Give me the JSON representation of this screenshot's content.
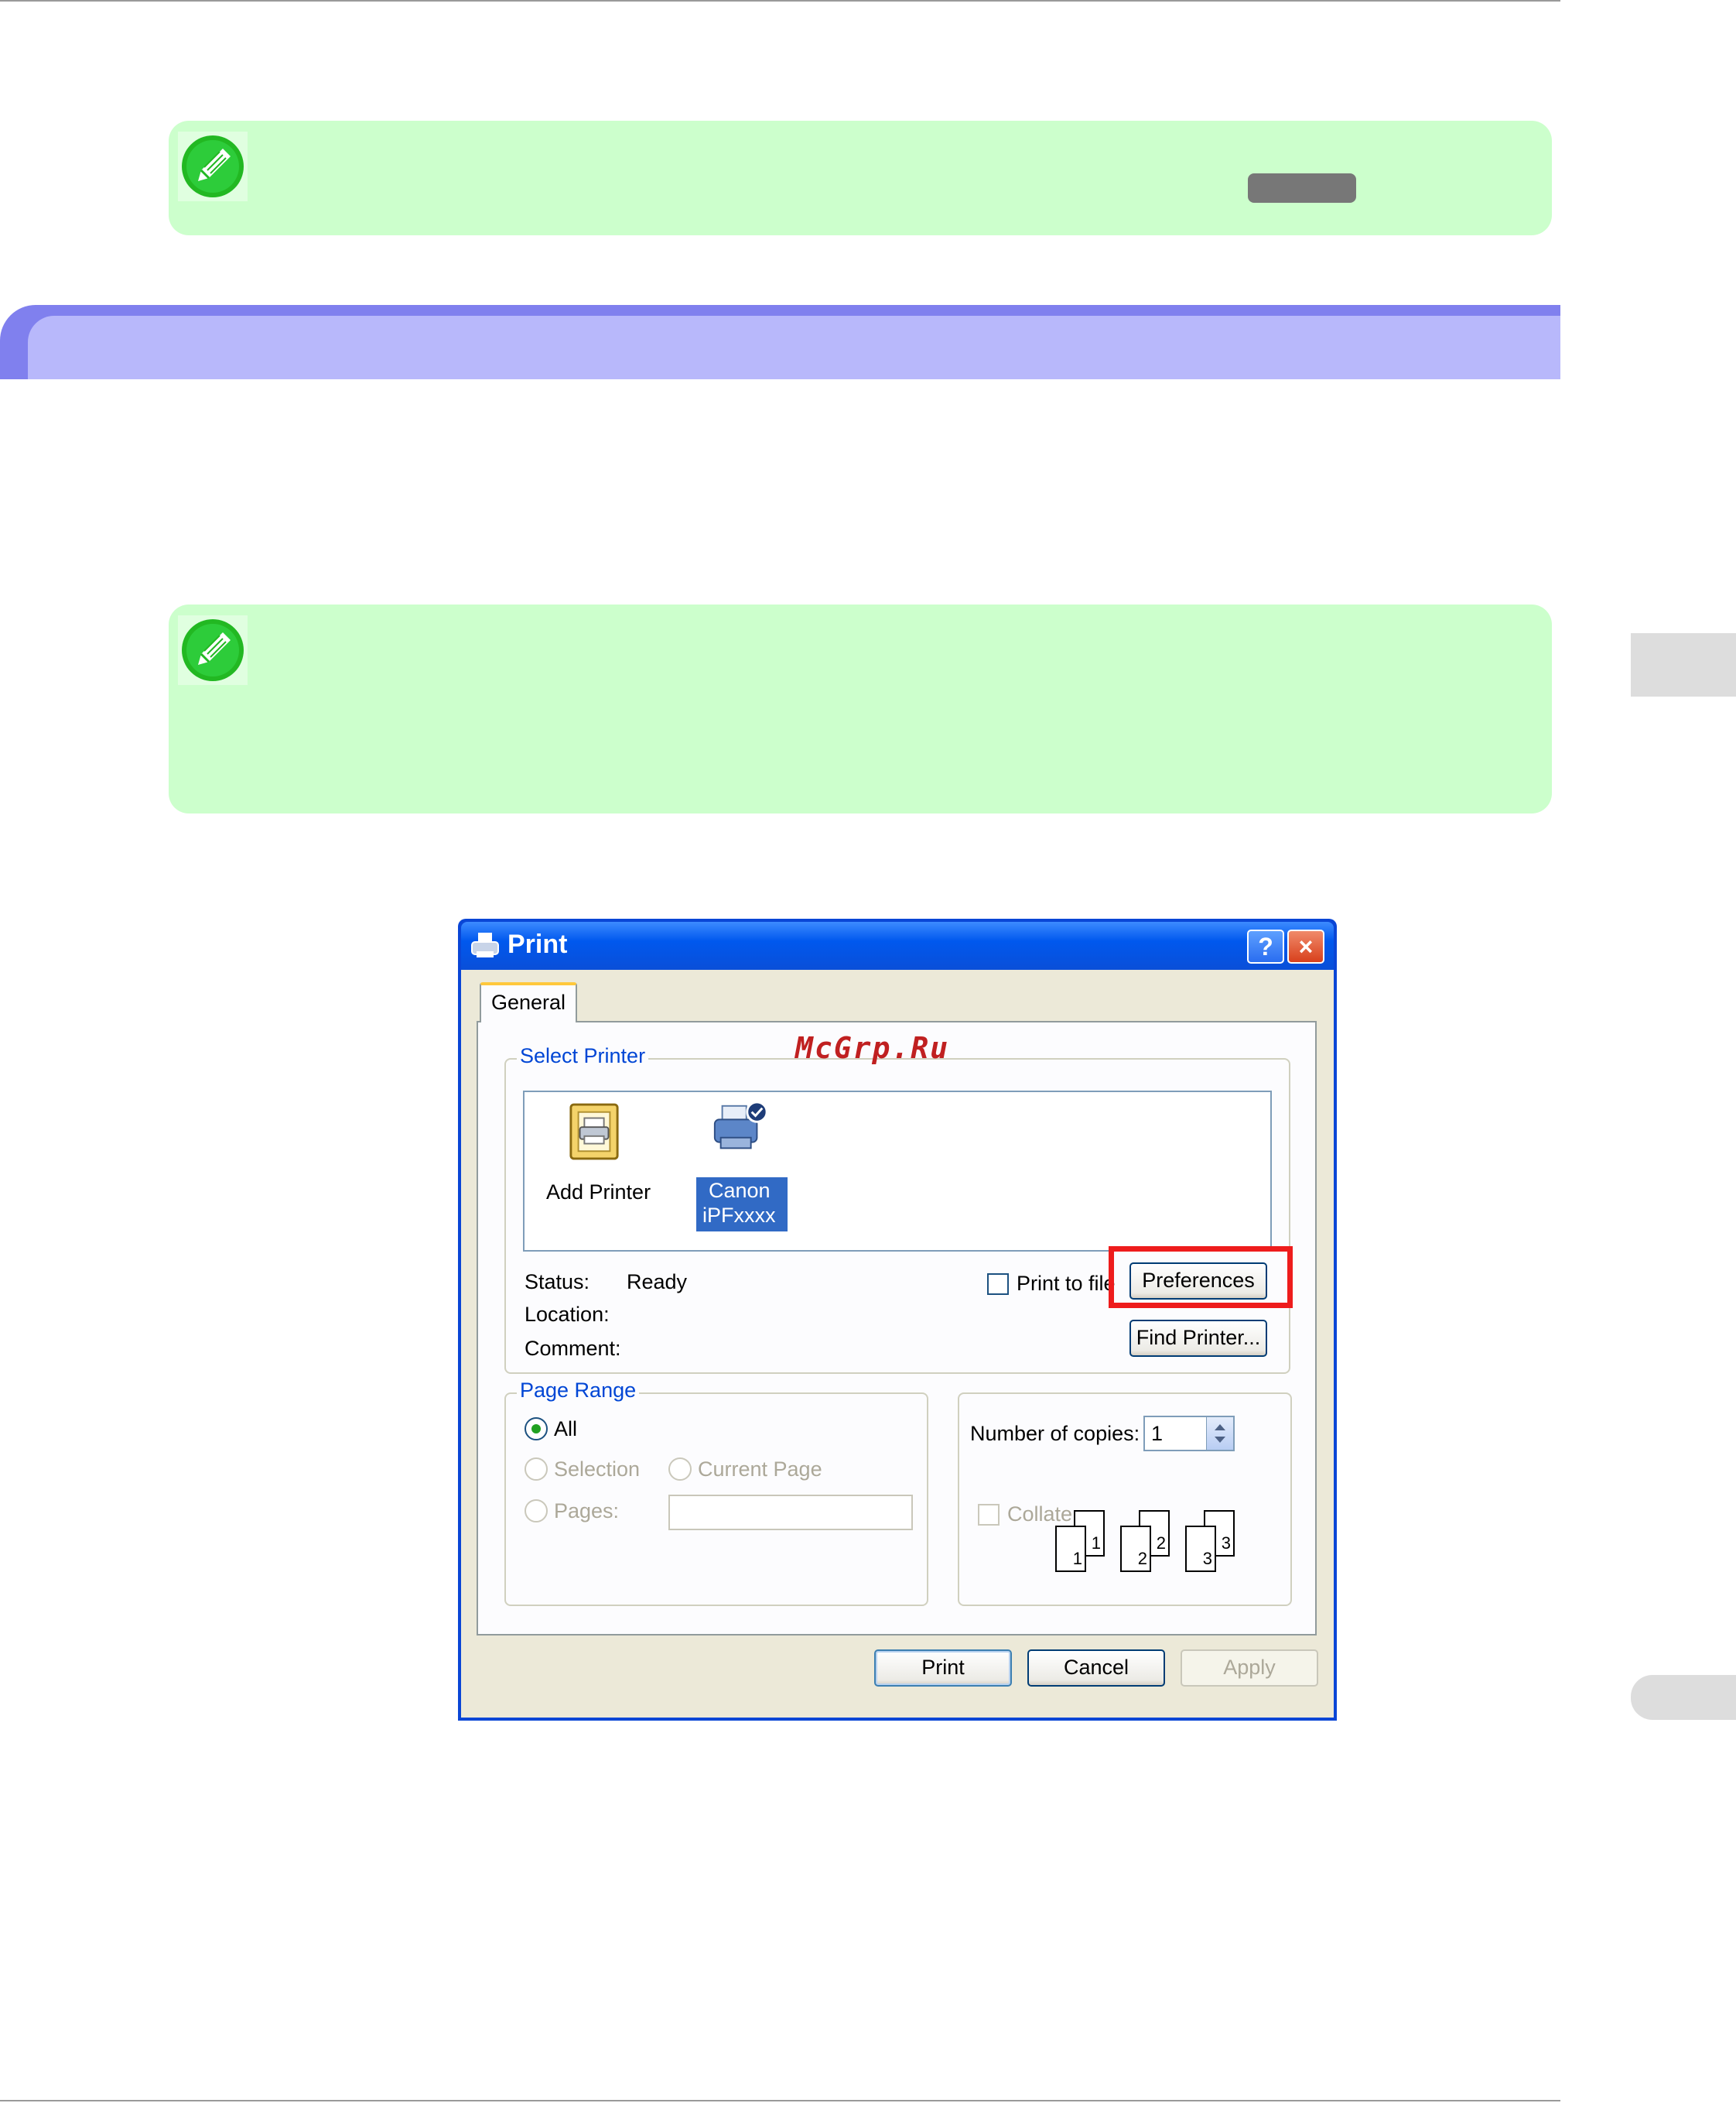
{
  "watermark": "McGrp.Ru",
  "dialog": {
    "title": "Print",
    "help_glyph": "?",
    "close_glyph": "×",
    "tab_general": "General",
    "select_printer_label": "Select Printer",
    "printers": [
      {
        "label_lines": [
          "Add Printer"
        ]
      },
      {
        "label_lines": [
          "Canon",
          "iPFxxxx"
        ]
      }
    ],
    "status_label": "Status:",
    "status_value": "Ready",
    "location_label": "Location:",
    "comment_label": "Comment:",
    "print_to_file": "Print to file",
    "preferences_button": "Preferences",
    "find_printer_button": "Find Printer...",
    "page_range_label": "Page Range",
    "radio_all": "All",
    "radio_selection": "Selection",
    "radio_current_page": "Current Page",
    "radio_pages": "Pages:",
    "copies_label": "Number of copies:",
    "copies_value": "1",
    "collate_label": "Collate",
    "collate_pages": [
      "1",
      "1",
      "2",
      "2",
      "3",
      "3"
    ],
    "print_button": "Print",
    "cancel_button": "Cancel",
    "apply_button": "Apply"
  },
  "colors": {
    "note_bg": "#ccffcc",
    "section_bar": "#8080ee",
    "section_bar_inner": "#b8b8fb",
    "highlight_frame": "#ee1c1c",
    "xp_title_blue": "#0058ee"
  }
}
